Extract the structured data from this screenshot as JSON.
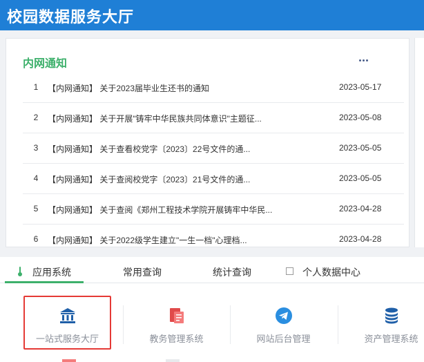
{
  "header": {
    "title": "校园数据服务大厅"
  },
  "notice": {
    "title": "内网通知",
    "items": [
      {
        "num": "1",
        "text": "【内网通知】 关于2023届毕业生还书的通知",
        "date": "2023-05-17"
      },
      {
        "num": "2",
        "text": "【内网通知】 关于开展\"铸牢中华民族共同体意识\"主题征...",
        "date": "2023-05-08"
      },
      {
        "num": "3",
        "text": "【内网通知】 关于查看校党字〔2023〕22号文件的通...",
        "date": "2023-05-05"
      },
      {
        "num": "4",
        "text": "【内网通知】 关于查阅校党字〔2023〕21号文件的通...",
        "date": "2023-05-05"
      },
      {
        "num": "5",
        "text": "【内网通知】 关于查阅《郑州工程技术学院开展铸牢中华民...",
        "date": "2023-04-28"
      },
      {
        "num": "6",
        "text": "【内网通知】 关于2022级学生建立\"一生一档\"心理档...",
        "date": "2023-04-28"
      }
    ]
  },
  "tabs": [
    {
      "label": "应用系统",
      "active": true
    },
    {
      "label": "常用查询",
      "active": false
    },
    {
      "label": "统计查询",
      "active": false
    },
    {
      "label": "个人数据中心",
      "active": false
    }
  ],
  "apps": [
    {
      "label": "一站式服务大厅",
      "icon": "bank-icon",
      "color": "#1f5fa8"
    },
    {
      "label": "教务管理系统",
      "icon": "document-icon",
      "color": "#e04a4a"
    },
    {
      "label": "网站后台管理",
      "icon": "telegram-icon",
      "color": "#2a8ee0"
    },
    {
      "label": "资产管理系统",
      "icon": "database-icon",
      "color": "#1f5fa8"
    }
  ],
  "colors": {
    "brand": "#1f7fd6",
    "accent": "#3db06b",
    "highlight": "#e53935"
  }
}
